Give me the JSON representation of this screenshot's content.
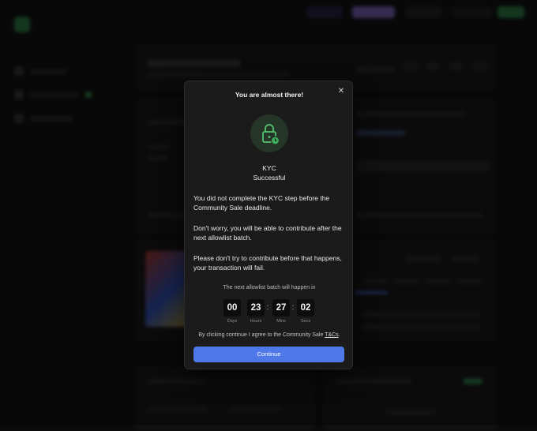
{
  "modal": {
    "title": "You are almost there!",
    "close_icon": "close-icon",
    "status_icon": "lock-clock-icon",
    "status_label": "KYC",
    "status_value": "Successful",
    "paragraphs": [
      "You did not complete the KYC step before the Community Sale deadline.",
      "Don't worry, you will be able to contribute after the next allowlist batch.",
      "Please don't try to contribute before that happens, your transaction will fail."
    ],
    "countdown_caption": "The next allowlist batch will happen in",
    "countdown": [
      {
        "value": "00",
        "label": "Days"
      },
      {
        "value": "23",
        "label": "Hours"
      },
      {
        "value": "27",
        "label": "Mins"
      },
      {
        "value": "02",
        "label": "Secs"
      }
    ],
    "agree_text": "By clicking continue I agree to the Community Sale",
    "agree_link": "T&Cs",
    "agree_suffix": ".",
    "continue_label": "Continue"
  },
  "colors": {
    "accent": "#4f78e8",
    "success": "#3fae5c",
    "modal_bg": "#1b1b1c"
  }
}
